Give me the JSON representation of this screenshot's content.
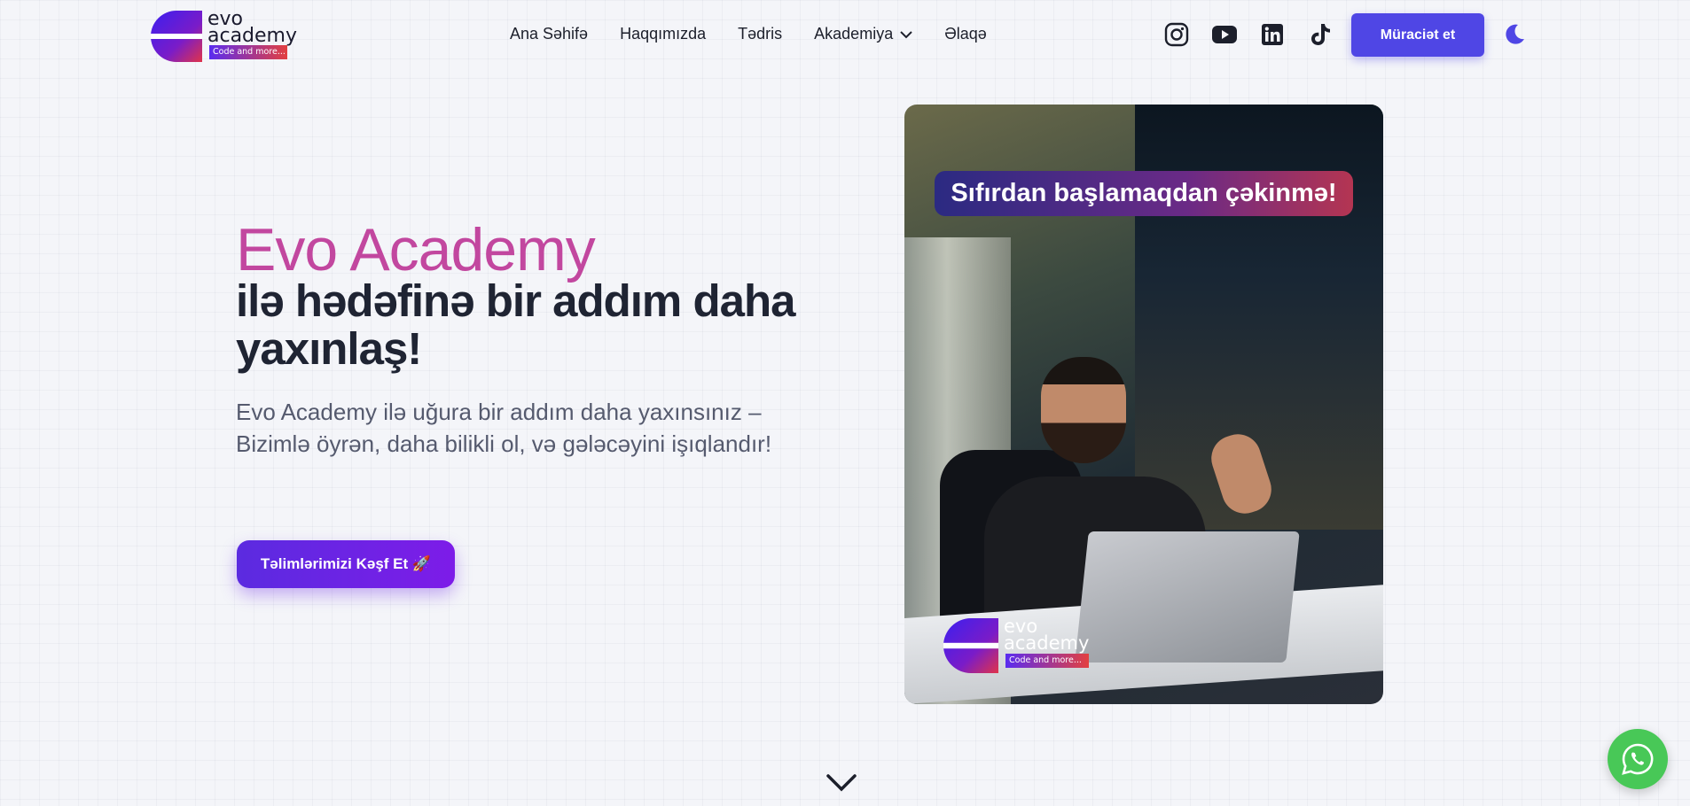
{
  "logo": {
    "line1": "evo",
    "line2": "academy",
    "tagline": "Code and more..."
  },
  "nav": {
    "items": [
      {
        "label": "Ana Səhifə"
      },
      {
        "label": "Haqqımızda"
      },
      {
        "label": "Tədris"
      },
      {
        "label": "Akademiya",
        "has_dropdown": true
      },
      {
        "label": "Əlaqə"
      }
    ]
  },
  "socials": [
    "instagram-icon",
    "youtube-icon",
    "linkedin-icon",
    "tiktok-icon"
  ],
  "header": {
    "apply_label": "Müraciət et",
    "theme_icon": "moon-icon"
  },
  "hero": {
    "title_accent": "Evo Academy",
    "title_main": "ilə hədəfinə bir addım daha yaxınlaş!",
    "subtitle": "Evo Academy ilə uğura bir addım daha yaxınsınız – Bizimlə öyrən, daha bilikli ol, və gələcəyini işıqlandır!",
    "cta_label": "Təlimlərimizi Kəşf Et 🚀"
  },
  "hero_image": {
    "banner_text": "Sıfırdan başlamaqdan çəkinmə!",
    "logo_line1": "evo",
    "logo_line2": "academy",
    "logo_tagline": "Code and more..."
  },
  "colors": {
    "accent": "#4f46e5",
    "title_accent": "#c2479f",
    "cta_start": "#5b2be0",
    "cta_end": "#7d1ce8",
    "whatsapp": "#48c857"
  }
}
